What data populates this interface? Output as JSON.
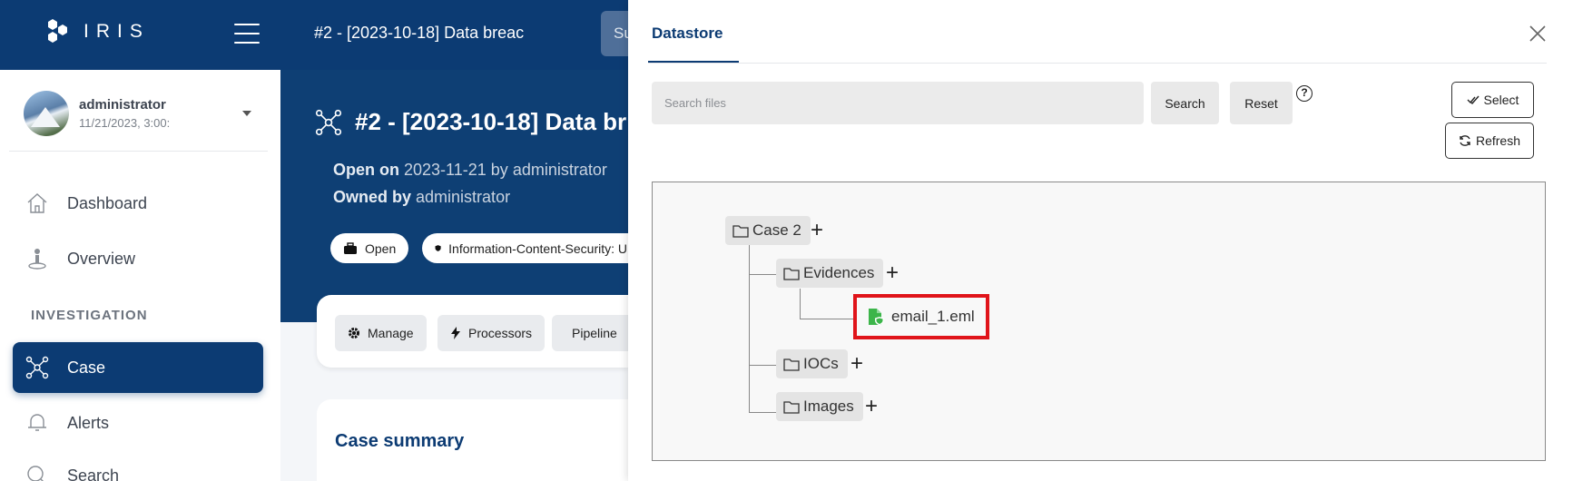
{
  "app": {
    "logo_text": "IRIS",
    "top_title": "#2 - [2023-10-18] Data breac",
    "top_search_partial": "Su"
  },
  "user": {
    "name": "administrator",
    "datetime": "11/21/2023, 3:00:"
  },
  "nav": {
    "section_investigation": "INVESTIGATION",
    "items": [
      {
        "label": "Dashboard",
        "icon": "home-icon"
      },
      {
        "label": "Overview",
        "icon": "overview-icon"
      },
      {
        "label": "Case",
        "icon": "case-network-icon",
        "active": true
      },
      {
        "label": "Alerts",
        "icon": "bell-icon"
      },
      {
        "label": "Search",
        "icon": "search-icon"
      }
    ]
  },
  "case": {
    "title": "#2 - [2023-10-18] Data br",
    "open_label": "Open on",
    "open_date": "2023-11-21",
    "by_label": "by",
    "open_by": "administrator",
    "owned_label": "Owned by",
    "owner": "administrator",
    "status_chip": "Open",
    "classification_chip": "Information-Content-Security: U",
    "actions": [
      "Manage",
      "Processors",
      "Pipeline"
    ],
    "summary_title": "Case summary"
  },
  "datastore": {
    "tab_label": "Datastore",
    "search_placeholder": "Search files",
    "search_button": "Search",
    "reset_button": "Reset",
    "help_symbol": "?",
    "select_button": "Select",
    "refresh_button": "Refresh",
    "tree": {
      "root": "Case 2",
      "folders": [
        "Evidences",
        "IOCs",
        "Images"
      ],
      "file": "email_1.eml"
    },
    "plus_symbol": "+"
  },
  "colors": {
    "brand": "#0c3b73",
    "highlight": "#e0141a",
    "file_icon": "#3cb54a"
  }
}
